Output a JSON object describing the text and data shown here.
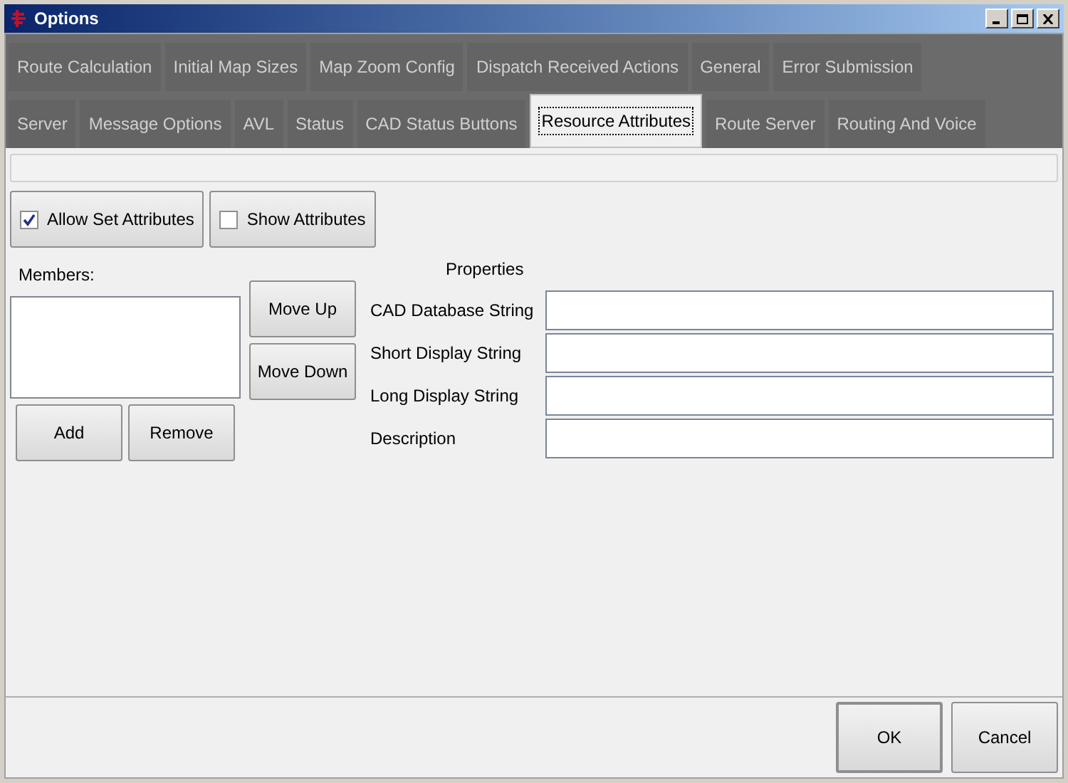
{
  "window": {
    "title": "Options"
  },
  "tab_rows": [
    [
      {
        "label": "Route Calculation",
        "selected": false
      },
      {
        "label": "Initial Map Sizes",
        "selected": false
      },
      {
        "label": "Map Zoom Config",
        "selected": false
      },
      {
        "label": "Dispatch Received Actions",
        "selected": false
      },
      {
        "label": "General",
        "selected": false
      },
      {
        "label": "Error Submission",
        "selected": false
      }
    ],
    [
      {
        "label": "Server",
        "selected": false
      },
      {
        "label": "Message Options",
        "selected": false
      },
      {
        "label": "AVL",
        "selected": false
      },
      {
        "label": "Status",
        "selected": false
      },
      {
        "label": "CAD Status Buttons",
        "selected": false
      },
      {
        "label": "Resource Attributes",
        "selected": true
      },
      {
        "label": "Route Server",
        "selected": false
      },
      {
        "label": "Routing And Voice",
        "selected": false
      }
    ]
  ],
  "toggles": [
    {
      "label": "Allow Set Attributes",
      "checked": true
    },
    {
      "label": "Show Attributes",
      "checked": false
    }
  ],
  "members": {
    "label": "Members:",
    "move_buttons": [
      "Move Up",
      "Move Down"
    ],
    "buttons": [
      "Add",
      "Remove"
    ]
  },
  "properties": {
    "title": "Properties",
    "fields": [
      {
        "label": "CAD Database String"
      },
      {
        "label": "Short Display String"
      },
      {
        "label": "Long Display String"
      },
      {
        "label": "Description"
      }
    ]
  },
  "dialog_buttons": [
    {
      "label": "OK",
      "default": true
    },
    {
      "label": "Cancel",
      "default": false
    }
  ]
}
